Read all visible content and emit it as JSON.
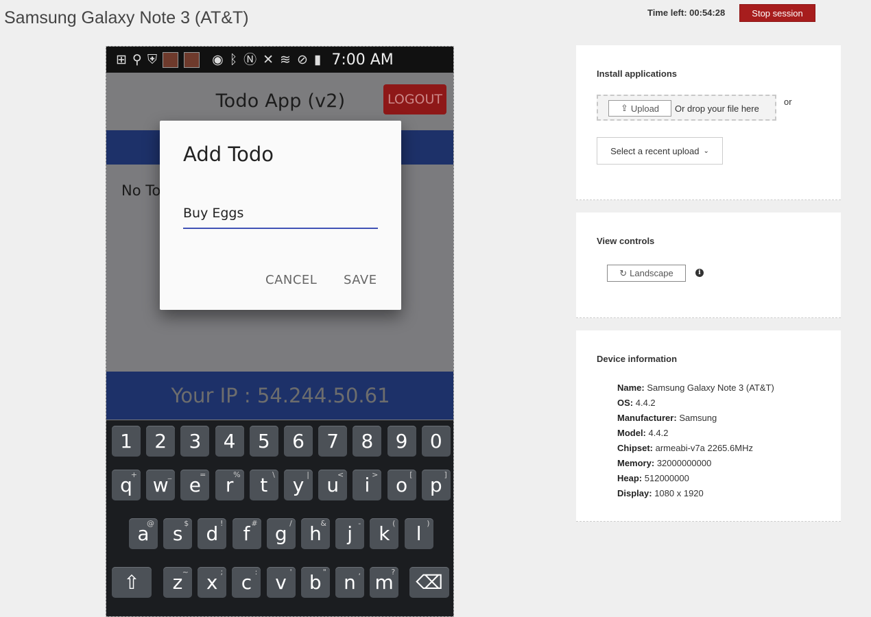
{
  "header": {
    "title": "Samsung Galaxy Note 3 (AT&T)",
    "time_left": "Time left: 00:54:28",
    "stop_label": "Stop session",
    "stop_color": "#a71d1d"
  },
  "phone": {
    "status_time": "7:00 AM",
    "app_title": "Todo App (v2)",
    "logout_label": "LOGOUT",
    "empty_text": "No To",
    "ip_text": "Your IP : 54.244.50.61",
    "dialog": {
      "title": "Add Todo",
      "input_value": "Buy Eggs",
      "cancel_label": "CANCEL",
      "save_label": "SAVE"
    },
    "keyboard": {
      "row1": [
        "1",
        "2",
        "3",
        "4",
        "5",
        "6",
        "7",
        "8",
        "9",
        "0"
      ],
      "row2": [
        "q",
        "w",
        "e",
        "r",
        "t",
        "y",
        "u",
        "i",
        "o",
        "p"
      ],
      "row2_hints": [
        "+",
        "_",
        "=",
        "%",
        "\\",
        "|",
        "<",
        ">",
        "[",
        "]"
      ],
      "row3": [
        "a",
        "s",
        "d",
        "f",
        "g",
        "h",
        "j",
        "k",
        "l"
      ],
      "row3_hints": [
        "@",
        "$",
        "!",
        "#",
        "/",
        "&",
        "-",
        "(",
        ")"
      ],
      "row4": [
        "z",
        "x",
        "c",
        "v",
        "b",
        "n",
        "m"
      ],
      "row4_hints": [
        "~",
        ";",
        ":",
        "'",
        "\"",
        ",",
        "?"
      ]
    }
  },
  "install": {
    "heading": "Install applications",
    "upload_label": "Upload",
    "drop_text": "Or drop your file here",
    "or_text": "or",
    "recent_label": "Select a recent upload"
  },
  "view_controls": {
    "heading": "View controls",
    "landscape_label": "Landscape"
  },
  "device_info": {
    "heading": "Device information",
    "rows": [
      {
        "label": "Name:",
        "value": "Samsung Galaxy Note 3 (AT&T)"
      },
      {
        "label": "OS:",
        "value": "4.4.2"
      },
      {
        "label": "Manufacturer:",
        "value": "Samsung"
      },
      {
        "label": "Model:",
        "value": "4.4.2"
      },
      {
        "label": "Chipset:",
        "value": "armeabi-v7a 2265.6MHz"
      },
      {
        "label": "Memory:",
        "value": "32000000000"
      },
      {
        "label": "Heap:",
        "value": "512000000"
      },
      {
        "label": "Display:",
        "value": "1080 x 1920"
      }
    ]
  }
}
